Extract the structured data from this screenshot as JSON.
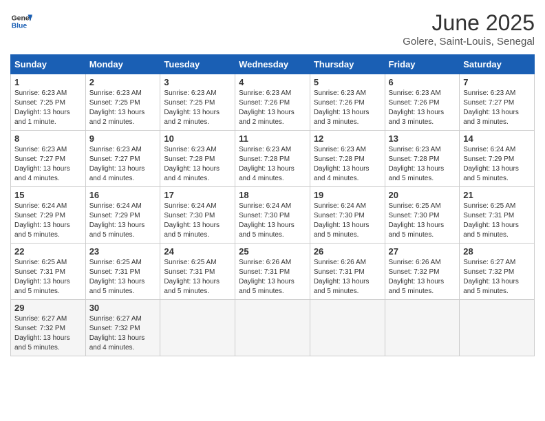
{
  "header": {
    "logo_line1": "General",
    "logo_line2": "Blue",
    "month": "June 2025",
    "location": "Golere, Saint-Louis, Senegal"
  },
  "weekdays": [
    "Sunday",
    "Monday",
    "Tuesday",
    "Wednesday",
    "Thursday",
    "Friday",
    "Saturday"
  ],
  "weeks": [
    [
      {
        "day": "1",
        "sunrise": "6:23 AM",
        "sunset": "7:25 PM",
        "daylight": "13 hours and 1 minute."
      },
      {
        "day": "2",
        "sunrise": "6:23 AM",
        "sunset": "7:25 PM",
        "daylight": "13 hours and 2 minutes."
      },
      {
        "day": "3",
        "sunrise": "6:23 AM",
        "sunset": "7:25 PM",
        "daylight": "13 hours and 2 minutes."
      },
      {
        "day": "4",
        "sunrise": "6:23 AM",
        "sunset": "7:26 PM",
        "daylight": "13 hours and 2 minutes."
      },
      {
        "day": "5",
        "sunrise": "6:23 AM",
        "sunset": "7:26 PM",
        "daylight": "13 hours and 3 minutes."
      },
      {
        "day": "6",
        "sunrise": "6:23 AM",
        "sunset": "7:26 PM",
        "daylight": "13 hours and 3 minutes."
      },
      {
        "day": "7",
        "sunrise": "6:23 AM",
        "sunset": "7:27 PM",
        "daylight": "13 hours and 3 minutes."
      }
    ],
    [
      {
        "day": "8",
        "sunrise": "6:23 AM",
        "sunset": "7:27 PM",
        "daylight": "13 hours and 4 minutes."
      },
      {
        "day": "9",
        "sunrise": "6:23 AM",
        "sunset": "7:27 PM",
        "daylight": "13 hours and 4 minutes."
      },
      {
        "day": "10",
        "sunrise": "6:23 AM",
        "sunset": "7:28 PM",
        "daylight": "13 hours and 4 minutes."
      },
      {
        "day": "11",
        "sunrise": "6:23 AM",
        "sunset": "7:28 PM",
        "daylight": "13 hours and 4 minutes."
      },
      {
        "day": "12",
        "sunrise": "6:23 AM",
        "sunset": "7:28 PM",
        "daylight": "13 hours and 4 minutes."
      },
      {
        "day": "13",
        "sunrise": "6:23 AM",
        "sunset": "7:28 PM",
        "daylight": "13 hours and 5 minutes."
      },
      {
        "day": "14",
        "sunrise": "6:24 AM",
        "sunset": "7:29 PM",
        "daylight": "13 hours and 5 minutes."
      }
    ],
    [
      {
        "day": "15",
        "sunrise": "6:24 AM",
        "sunset": "7:29 PM",
        "daylight": "13 hours and 5 minutes."
      },
      {
        "day": "16",
        "sunrise": "6:24 AM",
        "sunset": "7:29 PM",
        "daylight": "13 hours and 5 minutes."
      },
      {
        "day": "17",
        "sunrise": "6:24 AM",
        "sunset": "7:30 PM",
        "daylight": "13 hours and 5 minutes."
      },
      {
        "day": "18",
        "sunrise": "6:24 AM",
        "sunset": "7:30 PM",
        "daylight": "13 hours and 5 minutes."
      },
      {
        "day": "19",
        "sunrise": "6:24 AM",
        "sunset": "7:30 PM",
        "daylight": "13 hours and 5 minutes."
      },
      {
        "day": "20",
        "sunrise": "6:25 AM",
        "sunset": "7:30 PM",
        "daylight": "13 hours and 5 minutes."
      },
      {
        "day": "21",
        "sunrise": "6:25 AM",
        "sunset": "7:31 PM",
        "daylight": "13 hours and 5 minutes."
      }
    ],
    [
      {
        "day": "22",
        "sunrise": "6:25 AM",
        "sunset": "7:31 PM",
        "daylight": "13 hours and 5 minutes."
      },
      {
        "day": "23",
        "sunrise": "6:25 AM",
        "sunset": "7:31 PM",
        "daylight": "13 hours and 5 minutes."
      },
      {
        "day": "24",
        "sunrise": "6:25 AM",
        "sunset": "7:31 PM",
        "daylight": "13 hours and 5 minutes."
      },
      {
        "day": "25",
        "sunrise": "6:26 AM",
        "sunset": "7:31 PM",
        "daylight": "13 hours and 5 minutes."
      },
      {
        "day": "26",
        "sunrise": "6:26 AM",
        "sunset": "7:31 PM",
        "daylight": "13 hours and 5 minutes."
      },
      {
        "day": "27",
        "sunrise": "6:26 AM",
        "sunset": "7:32 PM",
        "daylight": "13 hours and 5 minutes."
      },
      {
        "day": "28",
        "sunrise": "6:27 AM",
        "sunset": "7:32 PM",
        "daylight": "13 hours and 5 minutes."
      }
    ],
    [
      {
        "day": "29",
        "sunrise": "6:27 AM",
        "sunset": "7:32 PM",
        "daylight": "13 hours and 5 minutes."
      },
      {
        "day": "30",
        "sunrise": "6:27 AM",
        "sunset": "7:32 PM",
        "daylight": "13 hours and 4 minutes."
      },
      null,
      null,
      null,
      null,
      null
    ]
  ]
}
